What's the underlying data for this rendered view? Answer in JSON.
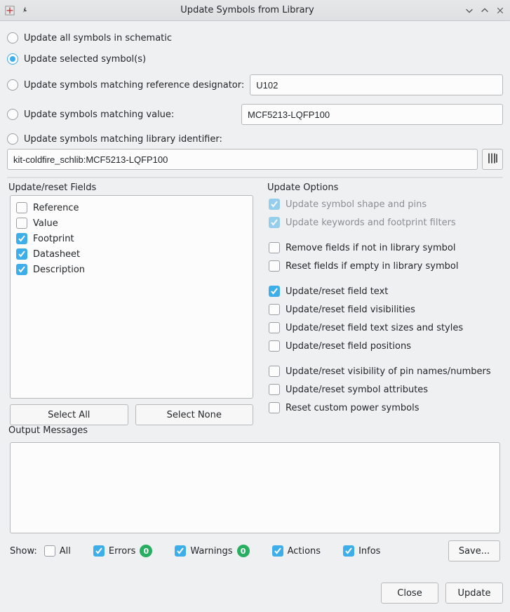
{
  "title": "Update Symbols from Library",
  "radios": {
    "all": "Update all symbols in schematic",
    "selected": "Update selected symbol(s)",
    "refdes": "Update symbols matching reference designator:",
    "value": "Update symbols matching value:",
    "libid": "Update symbols matching library identifier:",
    "chosen": "selected"
  },
  "inputs": {
    "refdes": "U102",
    "value": "MCF5213-LQFP100",
    "libid": "kit-coldfire_schlib:MCF5213-LQFP100"
  },
  "fields_legend": "Update/reset Fields",
  "fields": [
    {
      "label": "Reference",
      "checked": false
    },
    {
      "label": "Value",
      "checked": false
    },
    {
      "label": "Footprint",
      "checked": true
    },
    {
      "label": "Datasheet",
      "checked": true
    },
    {
      "label": "Description",
      "checked": true
    }
  ],
  "select_all": "Select All",
  "select_none": "Select None",
  "options_legend": "Update Options",
  "options_disabled": [
    "Update symbol shape and pins",
    "Update keywords and footprint filters"
  ],
  "options_group1": [
    {
      "label": "Remove fields if not in library symbol",
      "checked": false
    },
    {
      "label": "Reset fields if empty in library symbol",
      "checked": false
    }
  ],
  "options_group2": [
    {
      "label": "Update/reset field text",
      "checked": true
    },
    {
      "label": "Update/reset field visibilities",
      "checked": false
    },
    {
      "label": "Update/reset field text sizes and styles",
      "checked": false
    },
    {
      "label": "Update/reset field positions",
      "checked": false
    }
  ],
  "options_group3": [
    {
      "label": "Update/reset visibility of pin names/numbers",
      "checked": false
    },
    {
      "label": "Update/reset symbol attributes",
      "checked": false
    },
    {
      "label": "Reset custom power symbols",
      "checked": false
    }
  ],
  "output_legend": "Output Messages",
  "status": {
    "show": "Show:",
    "all": "All",
    "errors": "Errors",
    "errors_count": "0",
    "warnings": "Warnings",
    "warnings_count": "0",
    "actions": "Actions",
    "infos": "Infos",
    "save": "Save..."
  },
  "footer": {
    "close": "Close",
    "update": "Update"
  }
}
